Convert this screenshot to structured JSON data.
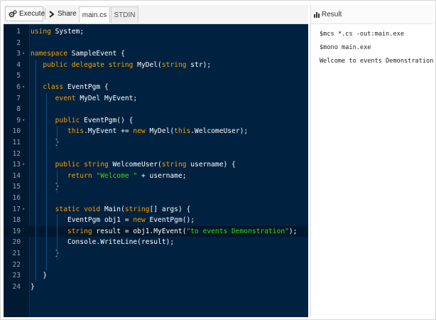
{
  "toolbar": {
    "execute_label": "Execute",
    "share_label": "Share",
    "tabs": [
      {
        "label": "main.cs",
        "active": true
      },
      {
        "label": "STDIN",
        "active": false
      }
    ]
  },
  "editor": {
    "active_line": 19,
    "lines": [
      {
        "n": "1",
        "fold": false,
        "tokens": [
          [
            "kw",
            "using"
          ],
          [
            "",
            " System;"
          ]
        ]
      },
      {
        "n": "2",
        "fold": false,
        "tokens": []
      },
      {
        "n": "3",
        "fold": true,
        "tokens": [
          [
            "kw",
            "namespace"
          ],
          [
            "",
            " SampleEvent {"
          ]
        ]
      },
      {
        "n": "4",
        "fold": false,
        "tokens": [
          [
            "",
            "   "
          ],
          [
            "kw",
            "public delegate string"
          ],
          [
            "",
            " MyDel("
          ],
          [
            "kw",
            "string"
          ],
          [
            "",
            " str);"
          ]
        ]
      },
      {
        "n": "5",
        "fold": false,
        "tokens": []
      },
      {
        "n": "6",
        "fold": true,
        "tokens": [
          [
            "",
            "   "
          ],
          [
            "kw",
            "class"
          ],
          [
            "",
            " EventPgm {"
          ]
        ]
      },
      {
        "n": "7",
        "fold": false,
        "tokens": [
          [
            "",
            "      "
          ],
          [
            "kw",
            "event"
          ],
          [
            "",
            " MyDel MyEvent;"
          ]
        ]
      },
      {
        "n": "8",
        "fold": false,
        "tokens": []
      },
      {
        "n": "9",
        "fold": true,
        "tokens": [
          [
            "",
            "      "
          ],
          [
            "kw",
            "public"
          ],
          [
            "",
            " EventPgm() {"
          ]
        ]
      },
      {
        "n": "10",
        "fold": false,
        "tokens": [
          [
            "",
            "         "
          ],
          [
            "this",
            "this"
          ],
          [
            "",
            ".MyEvent += "
          ],
          [
            "kw",
            "new"
          ],
          [
            "",
            " MyDel("
          ],
          [
            "this",
            "this"
          ],
          [
            "",
            ".WelcomeUser);"
          ]
        ]
      },
      {
        "n": "11",
        "fold": false,
        "tokens": [
          [
            "",
            "      }"
          ]
        ]
      },
      {
        "n": "12",
        "fold": false,
        "tokens": []
      },
      {
        "n": "13",
        "fold": true,
        "tokens": [
          [
            "",
            "      "
          ],
          [
            "kw",
            "public string"
          ],
          [
            "",
            " WelcomeUser("
          ],
          [
            "kw",
            "string"
          ],
          [
            "",
            " username) {"
          ]
        ]
      },
      {
        "n": "14",
        "fold": false,
        "tokens": [
          [
            "",
            "         "
          ],
          [
            "kw",
            "return"
          ],
          [
            "",
            " "
          ],
          [
            "str",
            "\"Welcome \""
          ],
          [
            "",
            " + username;"
          ]
        ]
      },
      {
        "n": "15",
        "fold": false,
        "tokens": [
          [
            "",
            "      }"
          ]
        ]
      },
      {
        "n": "16",
        "fold": false,
        "tokens": []
      },
      {
        "n": "17",
        "fold": true,
        "tokens": [
          [
            "",
            "      "
          ],
          [
            "kw",
            "static void"
          ],
          [
            "",
            " Main("
          ],
          [
            "kw",
            "string"
          ],
          [
            "",
            "[] args) {"
          ]
        ]
      },
      {
        "n": "18",
        "fold": false,
        "tokens": [
          [
            "",
            "         EventPgm obj1 = "
          ],
          [
            "kw",
            "new"
          ],
          [
            "",
            " EventPgm();"
          ]
        ]
      },
      {
        "n": "19",
        "fold": false,
        "tokens": [
          [
            "",
            "         "
          ],
          [
            "kw",
            "string"
          ],
          [
            "",
            " result = obj1.MyEvent("
          ],
          [
            "str",
            "\"to events Demonstration\""
          ],
          [
            "",
            ");"
          ]
        ]
      },
      {
        "n": "20",
        "fold": false,
        "tokens": [
          [
            "",
            "         Console.WriteLine(result);"
          ]
        ]
      },
      {
        "n": "21",
        "fold": false,
        "tokens": [
          [
            "",
            "      }"
          ]
        ]
      },
      {
        "n": "22",
        "fold": false,
        "tokens": []
      },
      {
        "n": "23",
        "fold": false,
        "tokens": [
          [
            "",
            "   }"
          ]
        ]
      },
      {
        "n": "24",
        "fold": false,
        "tokens": [
          [
            "",
            "}"
          ]
        ]
      }
    ]
  },
  "result": {
    "title": "Result",
    "output": [
      "$mcs *.cs -out:main.exe",
      "$mono main.exe",
      "Welcome to events Demonstration"
    ]
  },
  "icons": {
    "execute": "gears-icon",
    "share": "share-arrow-icon",
    "result": "bar-chart-icon",
    "fold": "fold-arrow-icon"
  },
  "colors": {
    "editor_bg": "#002240",
    "keyword": "#ff9d00",
    "string": "#3ad900",
    "text": "#ffffff"
  }
}
